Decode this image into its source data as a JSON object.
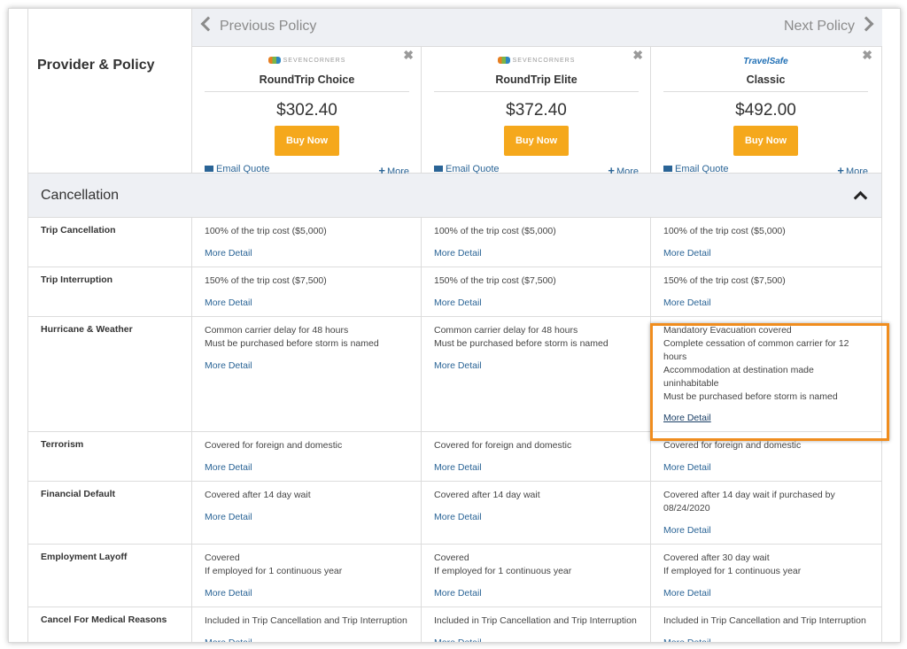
{
  "nav": {
    "prev": "Previous Policy",
    "next": "Next Policy"
  },
  "header_label": "Provider & Policy",
  "policies": [
    {
      "provider": "SEVENCORNERS",
      "name": "RoundTrip Choice",
      "price": "$302.40",
      "buy": "Buy Now",
      "email": "Email Quote",
      "more": "More"
    },
    {
      "provider": "SEVENCORNERS",
      "name": "RoundTrip Elite",
      "price": "$372.40",
      "buy": "Buy Now",
      "email": "Email Quote",
      "more": "More"
    },
    {
      "provider": "TravelSafe",
      "name": "Classic",
      "price": "$492.00",
      "buy": "Buy Now",
      "email": "Email Quote",
      "more": "More"
    }
  ],
  "section": "Cancellation",
  "more_detail": "More Detail",
  "rows": [
    {
      "label": "Trip Cancellation",
      "cells": [
        "100% of the trip cost ($5,000)",
        "100% of the trip cost ($5,000)",
        "100% of the trip cost ($5,000)"
      ]
    },
    {
      "label": "Trip Interruption",
      "cells": [
        "150% of the trip cost ($7,500)",
        "150% of the trip cost ($7,500)",
        "150% of the trip cost ($7,500)"
      ]
    },
    {
      "label": "Hurricane & Weather",
      "cells": [
        "Common carrier delay for 48 hours\nMust be purchased before storm is named",
        "Common carrier delay for 48 hours\nMust be purchased before storm is named",
        "Mandatory Evacuation covered\nComplete cessation of common carrier for 12 hours\nAccommodation at destination made uninhabitable\nMust be purchased before storm is named"
      ]
    },
    {
      "label": "Terrorism",
      "cells": [
        "Covered for foreign and domestic",
        "Covered for foreign and domestic",
        "Covered for foreign and domestic"
      ]
    },
    {
      "label": "Financial Default",
      "cells": [
        "Covered after 14 day wait",
        "Covered after 14 day wait",
        "Covered after 14 day wait if purchased by 08/24/2020"
      ]
    },
    {
      "label": "Employment Layoff",
      "cells": [
        "Covered\nIf employed for 1 continuous year",
        "Covered\nIf employed for 1 continuous year",
        "Covered after 30 day wait\nIf employed for 1 continuous year"
      ]
    },
    {
      "label": "Cancel For Medical Reasons",
      "cells": [
        "Included in Trip Cancellation and Trip Interruption",
        "Included in Trip Cancellation and Trip Interruption",
        "Included in Trip Cancellation and Trip Interruption"
      ]
    }
  ],
  "colors": {
    "accent": "#f5a81c",
    "link": "#2a6496",
    "highlight": "#f08d1e"
  }
}
